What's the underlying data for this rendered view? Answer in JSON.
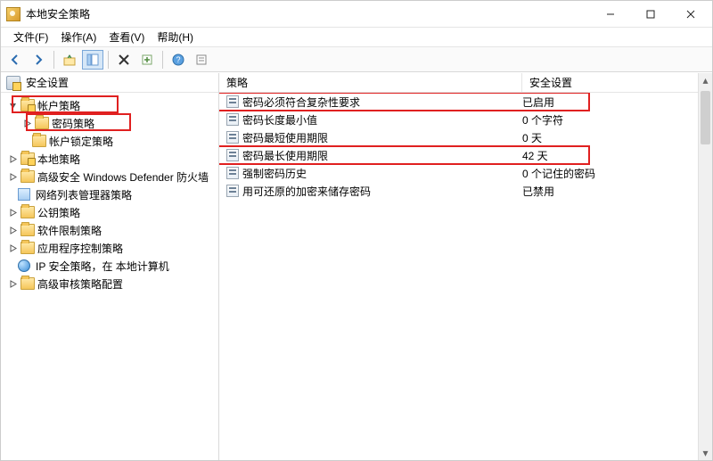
{
  "window": {
    "title": "本地安全策略"
  },
  "menu": {
    "file": "文件(F)",
    "action": "操作(A)",
    "view": "查看(V)",
    "help": "帮助(H)"
  },
  "tree": {
    "header": "安全设置",
    "root": "安全设置",
    "nodes": [
      {
        "label": "帐户策略",
        "children": [
          {
            "label": "密码策略"
          },
          {
            "label": "帐户锁定策略"
          }
        ]
      },
      {
        "label": "本地策略"
      },
      {
        "label": "高级安全 Windows Defender 防火墙"
      },
      {
        "label": "网络列表管理器策略"
      },
      {
        "label": "公钥策略"
      },
      {
        "label": "软件限制策略"
      },
      {
        "label": "应用程序控制策略"
      },
      {
        "label": "IP 安全策略，在 本地计算机"
      },
      {
        "label": "高级审核策略配置"
      }
    ]
  },
  "list": {
    "columns": {
      "policy": "策略",
      "setting": "安全设置"
    },
    "rows": [
      {
        "policy": "密码必须符合复杂性要求",
        "setting": "已启用"
      },
      {
        "policy": "密码长度最小值",
        "setting": "0 个字符"
      },
      {
        "policy": "密码最短使用期限",
        "setting": "0 天"
      },
      {
        "policy": "密码最长使用期限",
        "setting": "42 天"
      },
      {
        "policy": "强制密码历史",
        "setting": "0 个记住的密码"
      },
      {
        "policy": "用可还原的加密来储存密码",
        "setting": "已禁用"
      }
    ]
  }
}
